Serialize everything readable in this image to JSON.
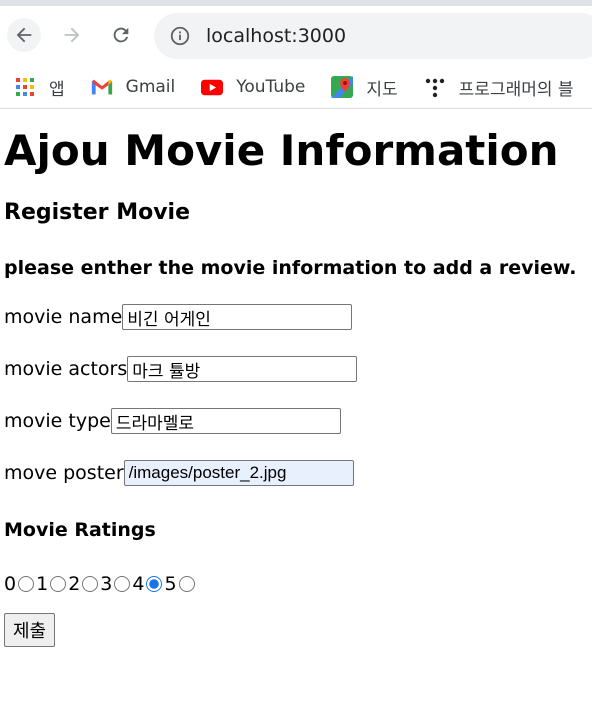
{
  "browser": {
    "url": "localhost:3000",
    "bookmarks": [
      {
        "label": "앱",
        "icon": "apps-grid-icon"
      },
      {
        "label": "Gmail",
        "icon": "gmail-icon"
      },
      {
        "label": "YouTube",
        "icon": "youtube-icon"
      },
      {
        "label": "지도",
        "icon": "maps-icon"
      },
      {
        "label": "프로그래머의 블",
        "icon": "programmers-icon"
      }
    ]
  },
  "page": {
    "title": "Ajou Movie Information",
    "section_title": "Register Movie",
    "instruction": "please enther the movie information to add a review.",
    "fields": {
      "name": {
        "label": "movie name",
        "value": "비긴 어게인"
      },
      "actors": {
        "label": "movie actors",
        "value": "마크 튤방"
      },
      "type": {
        "label": "movie type",
        "value": "드라마멜로"
      },
      "poster": {
        "label": "move poster",
        "value": "/images/poster_2.jpg"
      }
    },
    "ratings_title": "Movie Ratings",
    "ratings": [
      {
        "label": "0",
        "checked": false
      },
      {
        "label": "1",
        "checked": false
      },
      {
        "label": "2",
        "checked": false
      },
      {
        "label": "3",
        "checked": false
      },
      {
        "label": "4",
        "checked": true
      },
      {
        "label": "5",
        "checked": false
      }
    ],
    "submit_label": "제출"
  }
}
